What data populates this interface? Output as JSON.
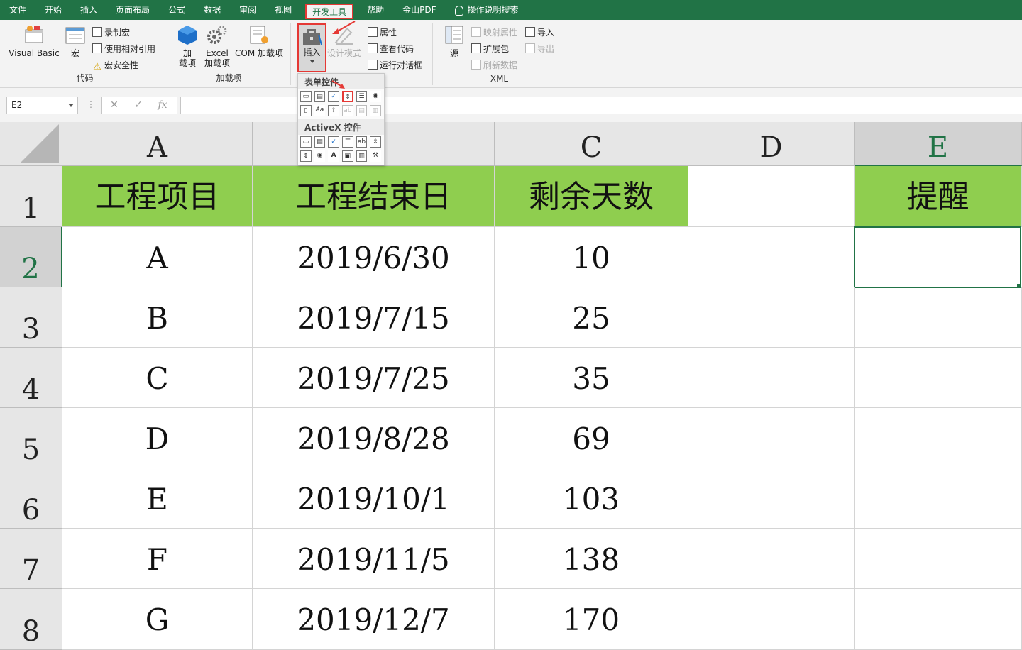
{
  "menu": {
    "tabs": [
      "文件",
      "开始",
      "插入",
      "页面布局",
      "公式",
      "数据",
      "审阅",
      "视图",
      "开发工具",
      "帮助",
      "金山PDF"
    ],
    "active_tab": "开发工具",
    "search_label": "操作说明搜索"
  },
  "ribbon": {
    "code_group": {
      "label": "代码",
      "visual_basic": "Visual Basic",
      "macros": "宏",
      "record_macro": "录制宏",
      "relative_ref": "使用相对引用",
      "macro_security": "宏安全性"
    },
    "addins_group": {
      "label": "加载项",
      "addins_l1": "加",
      "addins_l2": "载项",
      "excel_addins_l1": "Excel",
      "excel_addins_l2": "加载项",
      "com_addins": "COM 加载项"
    },
    "controls_group": {
      "insert": "插入",
      "design_mode": "设计模式",
      "properties": "属性",
      "view_code": "查看代码",
      "run_dialog": "运行对话框"
    },
    "xml_group": {
      "label": "XML",
      "source": "源",
      "map_properties": "映射属性",
      "expansion_packs": "扩展包",
      "refresh_data": "刷新数据",
      "import": "导入",
      "export": "导出"
    }
  },
  "gallery": {
    "form_controls": "表单控件",
    "activex_controls": "ActiveX 控件"
  },
  "formula_bar": {
    "name_box": "E2",
    "cancel": "✕",
    "enter": "✓",
    "fx": "fx",
    "value": ""
  },
  "sheet": {
    "columns": [
      "A",
      "",
      "C",
      "D",
      "E"
    ],
    "rows": [
      "1",
      "2",
      "3",
      "4",
      "5",
      "6",
      "7",
      "8"
    ],
    "header_row": [
      "工程项目",
      "工程结束日",
      "剩余天数",
      "",
      "提醒"
    ],
    "data": [
      [
        "A",
        "2019/6/30",
        "10"
      ],
      [
        "B",
        "2019/7/15",
        "25"
      ],
      [
        "C",
        "2019/7/25",
        "35"
      ],
      [
        "D",
        "2019/8/28",
        "69"
      ],
      [
        "E",
        "2019/10/1",
        "103"
      ],
      [
        "F",
        "2019/11/5",
        "138"
      ],
      [
        "G",
        "2019/12/7",
        "170"
      ]
    ],
    "selected_cell": "E2"
  },
  "colors": {
    "accent": "#217346",
    "header_fill": "#8fce4f",
    "highlight": "#e53935"
  }
}
